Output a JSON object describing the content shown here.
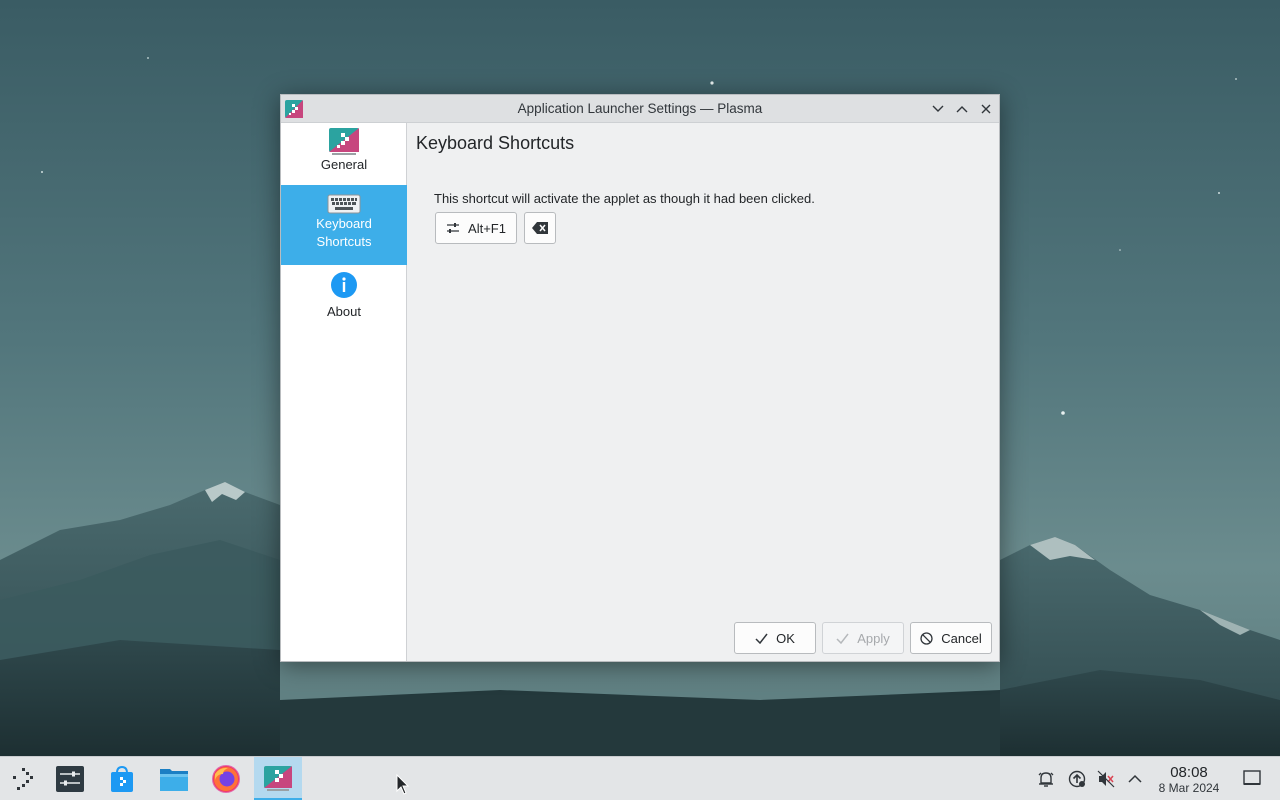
{
  "window": {
    "title": "Application Launcher Settings — Plasma",
    "controls": [
      "minimize",
      "maximize",
      "close"
    ]
  },
  "sidebar": {
    "items": [
      {
        "label": "General",
        "icon": "application-launcher-icon",
        "active": false
      },
      {
        "label": "Keyboard\nShortcuts",
        "label_line1": "Keyboard",
        "label_line2": "Shortcuts",
        "icon": "keyboard-icon",
        "active": true
      },
      {
        "label": "About",
        "icon": "info-icon",
        "active": false
      }
    ]
  },
  "content": {
    "title": "Keyboard Shortcuts",
    "description": "This shortcut will activate the applet as though it had been clicked.",
    "shortcut_value": "Alt+F1"
  },
  "footer": {
    "ok_label": "OK",
    "apply_label": "Apply",
    "cancel_label": "Cancel",
    "apply_enabled": false
  },
  "taskbar": {
    "items": [
      "application-launcher-icon",
      "system-settings-icon",
      "discover-store-icon",
      "file-manager-icon",
      "firefox-icon",
      "launcher-settings-icon"
    ],
    "active_item": "launcher-settings-icon"
  },
  "tray": {
    "icons": [
      "notifications-icon",
      "updates-icon",
      "volume-muted-icon",
      "chevron-up-icon"
    ],
    "clock_time": "08:08",
    "clock_date": "8 Mar 2024"
  },
  "colors": {
    "accent": "#3daee9",
    "window_bg": "#eff0f1",
    "titlebar_bg": "#dee0e2",
    "taskbar_bg": "#e3e5e7"
  }
}
